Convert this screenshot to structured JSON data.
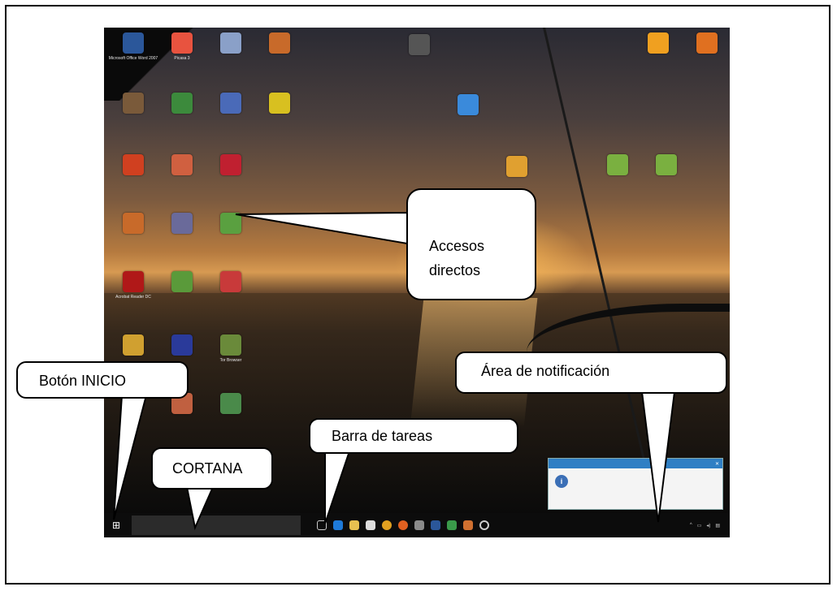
{
  "callouts": {
    "accesos": "Accesos\ndirectos",
    "inicio": "Botón INICIO",
    "cortana": "CORTANA",
    "barra": "Barra de tareas",
    "area": "Área de notificación"
  },
  "desktop_icons": [
    {
      "label": "Microsoft Office Word 2007",
      "color": "#2b579a"
    },
    {
      "label": "Picasa 3",
      "color": "#e8533f"
    },
    {
      "label": "",
      "color": "#8aa0c8"
    },
    {
      "label": "",
      "color": "#c86a2a"
    },
    {
      "label": "",
      "color": "#555555"
    },
    {
      "label": "",
      "color": "#f0a020"
    },
    {
      "label": "",
      "color": "#e07020"
    },
    {
      "label": "",
      "color": "#7a5a3a"
    },
    {
      "label": "",
      "color": "#3c8a3c"
    },
    {
      "label": "",
      "color": "#4a6ab8"
    },
    {
      "label": "",
      "color": "#d8c020"
    },
    {
      "label": "",
      "color": "#3a8adb"
    },
    {
      "label": "",
      "color": "#d04020"
    },
    {
      "label": "",
      "color": "#d06040"
    },
    {
      "label": "",
      "color": "#c02030"
    },
    {
      "label": "",
      "color": "#e0a030"
    },
    {
      "label": "",
      "color": "#7ab040"
    },
    {
      "label": "",
      "color": "#7ab040"
    },
    {
      "label": "",
      "color": "#c86a2a"
    },
    {
      "label": "",
      "color": "#6a6a9a"
    },
    {
      "label": "",
      "color": "#5aa040"
    },
    {
      "label": "Acrobat Reader DC",
      "color": "#b01818"
    },
    {
      "label": "",
      "color": "#5a9a3a"
    },
    {
      "label": "",
      "color": "#c83a3a"
    },
    {
      "label": "",
      "color": "#d0a030"
    },
    {
      "label": "",
      "color": "#2a3a9a"
    },
    {
      "label": "Tor Browser",
      "color": "#6a8a3a"
    },
    {
      "label": "",
      "color": "#c06040"
    },
    {
      "label": "",
      "color": "#4a8a4a"
    }
  ],
  "taskbar": {
    "start_icon": "windows-logo-icon",
    "search_placeholder": "",
    "clock_time": "",
    "clock_date": ""
  },
  "toast": {
    "title": "",
    "message": ""
  }
}
